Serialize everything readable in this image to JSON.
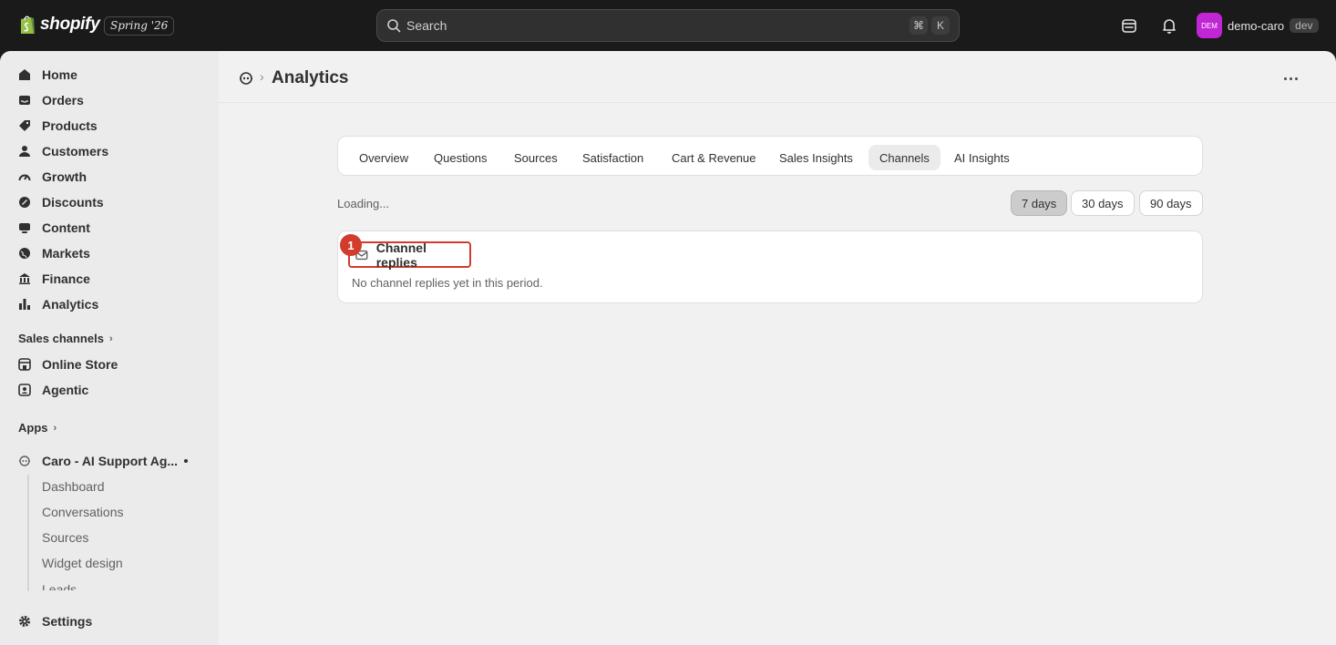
{
  "topbar": {
    "brand": "shopify",
    "release": "Spring '26",
    "search": {
      "placeholder": "Search",
      "shortcut_keys": [
        "⌘",
        "K"
      ]
    },
    "user": {
      "avatar_initials": "DEM",
      "name": "demo-caro",
      "badge": "dev"
    },
    "icons": [
      "storefront-icon",
      "bell-icon"
    ]
  },
  "sidebar": {
    "items": [
      {
        "label": "Home",
        "icon": "home-icon"
      },
      {
        "label": "Orders",
        "icon": "inbox-icon"
      },
      {
        "label": "Products",
        "icon": "tag-icon"
      },
      {
        "label": "Customers",
        "icon": "person-icon"
      },
      {
        "label": "Growth",
        "icon": "gauge-icon"
      },
      {
        "label": "Discounts",
        "icon": "discount-icon"
      },
      {
        "label": "Content",
        "icon": "content-icon"
      },
      {
        "label": "Markets",
        "icon": "globe-icon"
      },
      {
        "label": "Finance",
        "icon": "bank-icon"
      },
      {
        "label": "Analytics",
        "icon": "bar-chart-icon"
      }
    ],
    "sales_channels_label": "Sales channels",
    "channels": [
      {
        "label": "Online Store",
        "icon": "store-icon"
      },
      {
        "label": "Agentic",
        "icon": "agent-icon"
      }
    ],
    "apps_label": "Apps",
    "app": {
      "label": "Caro - AI Support Ag...",
      "sub_items": [
        "Dashboard",
        "Conversations",
        "Sources",
        "Widget design",
        "Leads"
      ]
    },
    "settings_label": "Settings"
  },
  "page": {
    "title": "Analytics",
    "tabs": [
      "Overview",
      "Questions",
      "Sources",
      "Satisfaction",
      "Cart & Revenue",
      "Sales Insights",
      "Channels",
      "AI Insights"
    ],
    "active_tab": "Channels",
    "loading_text": "Loading...",
    "ranges": [
      "7 days",
      "30 days",
      "90 days"
    ],
    "active_range": "7 days",
    "card": {
      "marker": "1",
      "title": "Channel replies",
      "empty_text": "No channel replies yet in this period."
    }
  },
  "colors": {
    "topbar_bg": "#1a1a1a",
    "avatar": "#c026d3",
    "highlight": "#d13c2c"
  }
}
